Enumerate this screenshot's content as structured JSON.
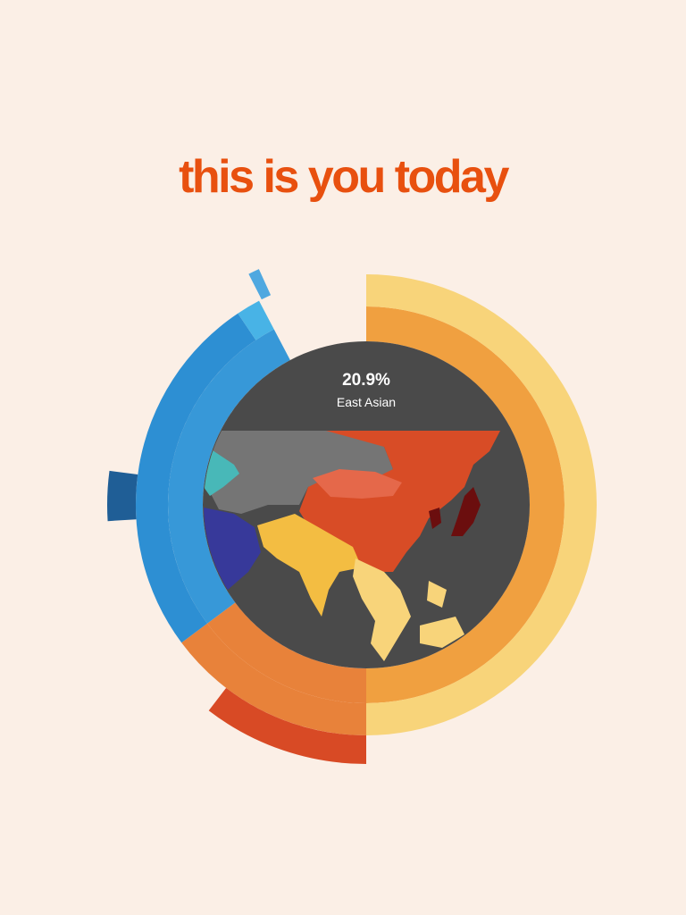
{
  "headline": "this is you today",
  "colors": {
    "headline": "#e8500f",
    "background": "#fbefe6",
    "center_disc": "#4a4a4a"
  },
  "chart_data": {
    "type": "sunburst",
    "center": {
      "value": "20.9%",
      "label": "East Asian"
    },
    "rings": [
      {
        "level": 1,
        "segments": [
          {
            "share": 0.5,
            "color": "#f0a040"
          },
          {
            "share": 0.148,
            "color": "#e8823a"
          },
          {
            "share": 0.275,
            "color": "#3798d8"
          }
        ]
      },
      {
        "level": 2,
        "segments": [
          {
            "share": 0.5,
            "color": "#f8d47a"
          },
          {
            "share": 0.148,
            "color": "#e8823a"
          },
          {
            "share": 0.258,
            "color": "#2d8fd3"
          },
          {
            "share": 0.017,
            "color": "#48b3e6"
          }
        ]
      },
      {
        "level": 3,
        "segments": [
          {
            "share": 0.104,
            "color": "#d84a25"
          },
          {
            "share": 0.031,
            "color": "#1f5e96"
          },
          {
            "share": 0.007,
            "color": "#4fa8e0"
          }
        ]
      }
    ],
    "map_regions": [
      {
        "name": "east-asia",
        "color": "#d84c26"
      },
      {
        "name": "south-asia",
        "color": "#f3bd42"
      },
      {
        "name": "southeast-asia",
        "color": "#f8d47a"
      },
      {
        "name": "middle-east",
        "color": "#37399a"
      },
      {
        "name": "central-asia",
        "color": "#757575"
      },
      {
        "name": "japan",
        "color": "#6b0e0e"
      }
    ]
  }
}
